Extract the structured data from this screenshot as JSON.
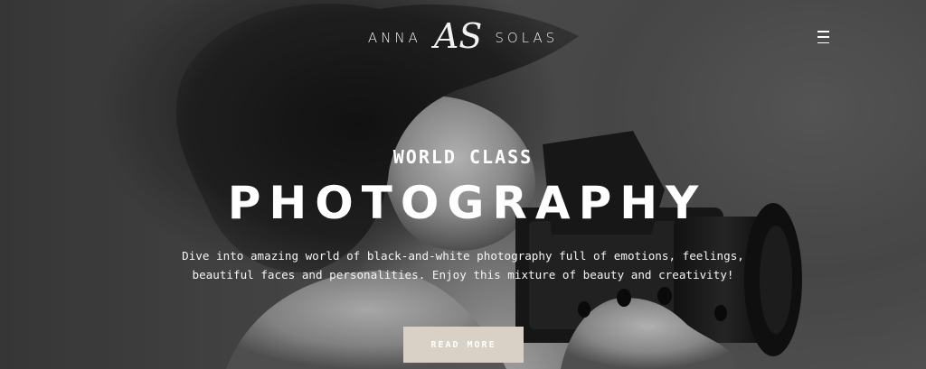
{
  "header": {
    "brand_first": "ANNA",
    "brand_monogram": "AS",
    "brand_last": "SOLAS",
    "menu_icon": "hamburger-menu-icon"
  },
  "hero": {
    "kicker": "WORLD CLASS",
    "headline": "PHOTOGRAPHY",
    "subcopy": "Dive into amazing world of black-and-white photography full of emotions, feelings, beautiful faces and personalities. Enjoy this mixture of beauty and creativity!",
    "cta_label": "READ MORE"
  },
  "colors": {
    "cta_background": "#d9d1c6",
    "text": "#ffffff"
  }
}
